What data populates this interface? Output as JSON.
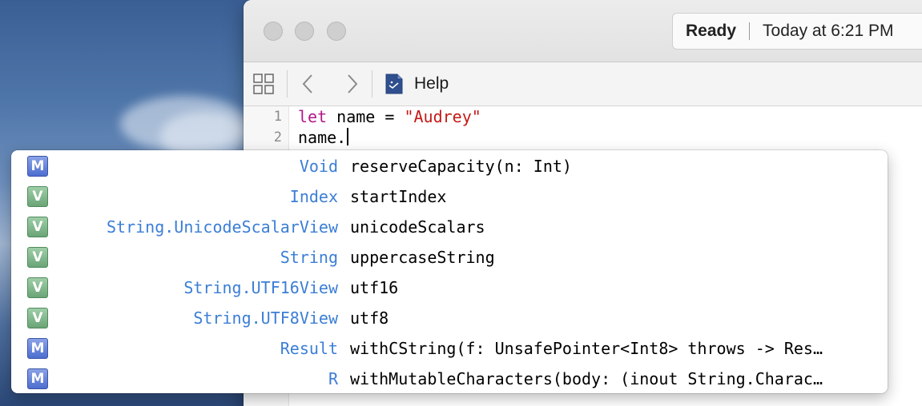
{
  "window": {
    "activity": {
      "status": "Ready",
      "time": "Today at 6:21 PM"
    },
    "toolbar": {
      "breadcrumb": "Help",
      "file_icon": "swift-file-icon"
    }
  },
  "editor": {
    "lines": [
      {
        "number": "1",
        "keyword": "let",
        "text": " name = ",
        "string": "\"Audrey\""
      },
      {
        "number": "2",
        "text": "name."
      }
    ]
  },
  "completion": {
    "items": [
      {
        "kind": "M",
        "type": "Void",
        "name": "reserveCapacity(n: Int)"
      },
      {
        "kind": "V",
        "type": "Index",
        "name": "startIndex"
      },
      {
        "kind": "V",
        "type": "String.UnicodeScalarView",
        "name": "unicodeScalars"
      },
      {
        "kind": "V",
        "type": "String",
        "name": "uppercaseString"
      },
      {
        "kind": "V",
        "type": "String.UTF16View",
        "name": "utf16"
      },
      {
        "kind": "V",
        "type": "String.UTF8View",
        "name": "utf8"
      },
      {
        "kind": "M",
        "type": "Result",
        "name": "withCString(f: UnsafePointer<Int8> throws -> Res…"
      },
      {
        "kind": "M",
        "type": "R",
        "name": "withMutableCharacters(body: (inout String.Charac…"
      }
    ]
  },
  "colors": {
    "keyword": "#b21889",
    "string": "#c41a16",
    "type": "#3b7ed6",
    "method_badge": "#5b7bd8",
    "variable_badge": "#78b084"
  }
}
